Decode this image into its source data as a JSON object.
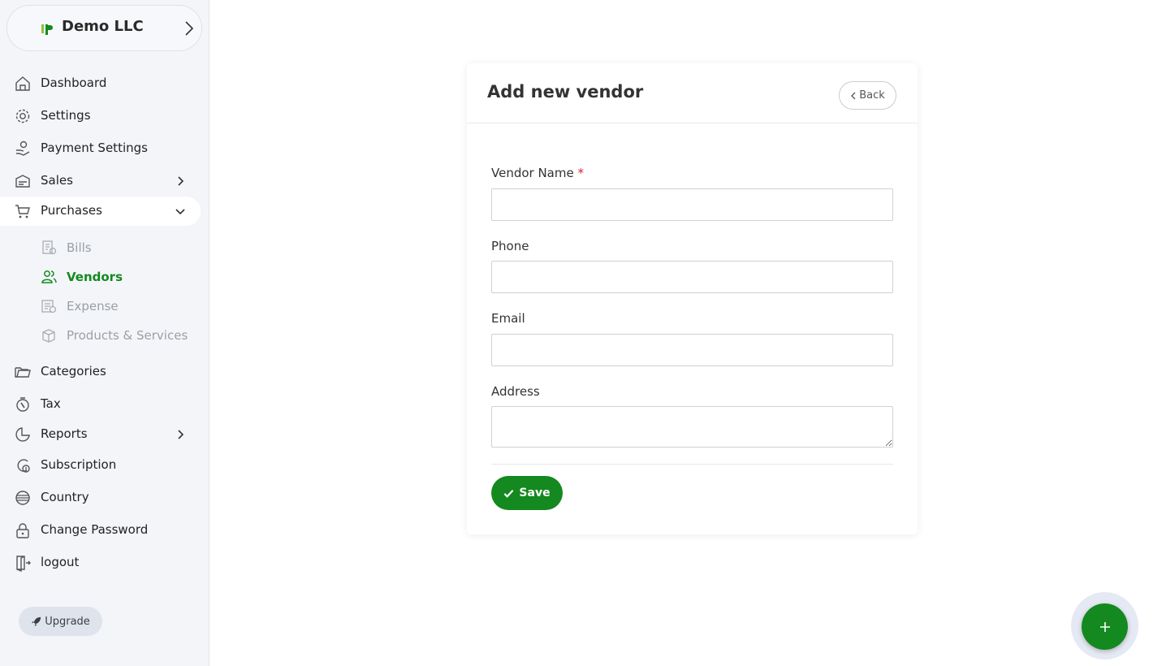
{
  "company": {
    "name": "Demo LLC",
    "logo_icon": "brand-logo-icon",
    "chevron_icon": "chevron-right-icon"
  },
  "sidebar": {
    "items": [
      {
        "label": "Dashboard",
        "icon": "home-icon"
      },
      {
        "label": "Settings",
        "icon": "gear-icon"
      },
      {
        "label": "Payment Settings",
        "icon": "money-hand-icon"
      },
      {
        "label": "Sales",
        "icon": "sales-icon",
        "expandable": true
      },
      {
        "label": "Purchases",
        "icon": "cart-icon",
        "expanded": true
      },
      {
        "label": "Categories",
        "icon": "folder-icon"
      },
      {
        "label": "Tax",
        "icon": "tax-icon"
      },
      {
        "label": "Reports",
        "icon": "pie-chart-icon",
        "expandable": true
      },
      {
        "label": "Subscription",
        "icon": "subscription-icon"
      },
      {
        "label": "Country",
        "icon": "globe-icon"
      },
      {
        "label": "Change Password",
        "icon": "lock-icon"
      },
      {
        "label": "logout",
        "icon": "logout-icon"
      }
    ],
    "purchases_sub": [
      {
        "label": "Bills",
        "icon": "bills-icon"
      },
      {
        "label": "Vendors",
        "icon": "users-icon",
        "active": true
      },
      {
        "label": "Expense",
        "icon": "expense-icon"
      },
      {
        "label": "Products & Services",
        "icon": "box-icon"
      }
    ],
    "upgrade_label": "Upgrade"
  },
  "form": {
    "title": "Add new vendor",
    "back_label": "Back",
    "fields": [
      {
        "label": "Vendor Name",
        "required_mark": "*",
        "value": ""
      },
      {
        "label": "Phone",
        "value": ""
      },
      {
        "label": "Email",
        "value": ""
      },
      {
        "label": "Address",
        "value": ""
      }
    ],
    "save_label": "Save"
  },
  "colors": {
    "accent": "#14891f",
    "sidebar_bg": "#f3f5f9",
    "required": "#d9232d"
  }
}
